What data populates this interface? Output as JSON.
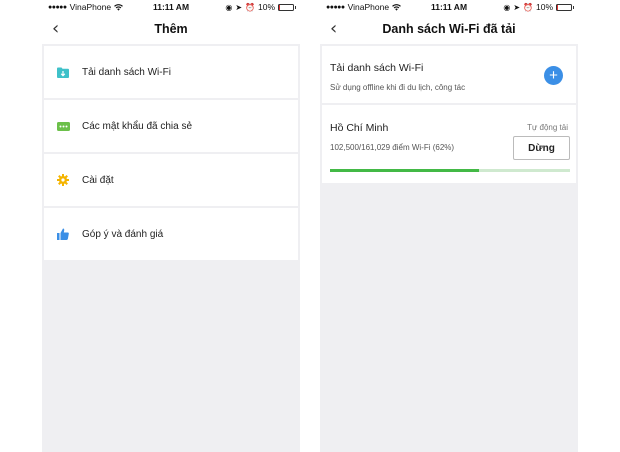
{
  "left": {
    "status": {
      "carrier": "VinaPhone",
      "time": "11:11 AM",
      "battery": "10%"
    },
    "nav": {
      "title": "Thêm"
    },
    "menu": [
      {
        "label": "Tải danh sách Wi-Fi",
        "icon": "folder-download-icon",
        "color": "#3fc1c9"
      },
      {
        "label": "Các mật khẩu đã chia sẻ",
        "icon": "password-dots-icon",
        "color": "#6cc04a"
      },
      {
        "label": "Cài đặt",
        "icon": "gear-icon",
        "color": "#f4b400"
      },
      {
        "label": "Góp ý và đánh giá",
        "icon": "thumbs-up-icon",
        "color": "#3b8fe6"
      }
    ]
  },
  "right": {
    "status": {
      "carrier": "VinaPhone",
      "time": "11:11 AM",
      "battery": "10%"
    },
    "nav": {
      "title": "Danh sách Wi-Fi đã tải"
    },
    "download_card": {
      "title": "Tải danh sách Wi-Fi",
      "subtitle": "Sử dụng offline khi đi du lịch, công tác",
      "add_label": "+"
    },
    "city_card": {
      "city": "Hồ Chí Minh",
      "auto_label": "Tự động tải",
      "progress_text": "102,500/161,029 điểm Wi-Fi (62%)",
      "stop_label": "Dừng",
      "progress": 0.62
    },
    "colors": {
      "accent": "#3b8fe6",
      "progress": "#43b946"
    }
  },
  "battery_level": 0.1
}
